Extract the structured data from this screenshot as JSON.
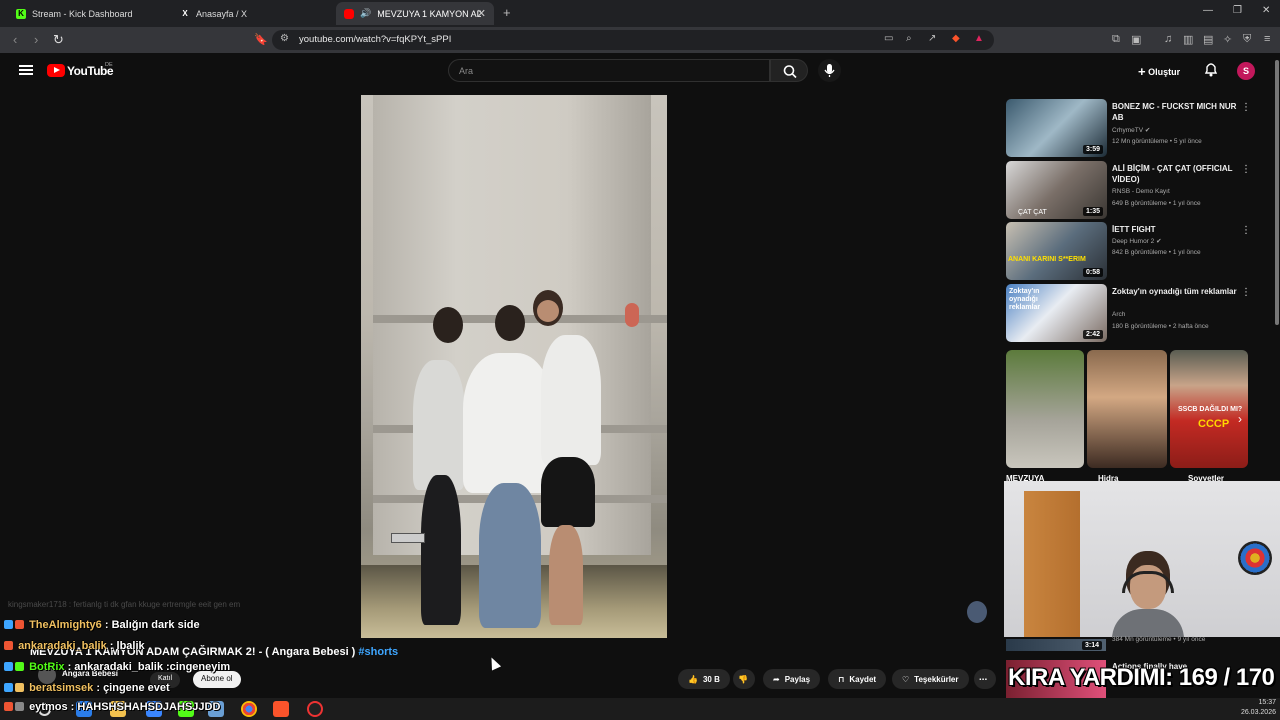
{
  "browser": {
    "tabs": [
      {
        "label": "Stream - Kick Dashboard",
        "icon": "kick-icon",
        "color": "#53fc18"
      },
      {
        "label": "Anasayfa / X",
        "icon": "x-icon",
        "color": "#ffffff"
      },
      {
        "label": "MEVZUYA 1 KAMYON ADAM",
        "icon": "youtube-icon",
        "color": "#ff0000",
        "active": true
      }
    ],
    "url": "youtube.com/watch?v=fqKPYt_sPPI"
  },
  "youtube": {
    "logo_text": "YouTube",
    "country_code": "DE",
    "search_placeholder": "Ara",
    "create_label": "Oluştur",
    "avatar_letter": "S"
  },
  "video": {
    "title": "MEVZUYA 1 KAMYON ADAM ÇAĞIRMAK 2! - ( Angara Bebesi )",
    "hashtag": "#shorts",
    "channel": "Angara Bebesi",
    "join_label": "Katıl",
    "subscribe_label": "Abone ol",
    "likes": "30 B",
    "share_label": "Paylaş",
    "save_label": "Kaydet",
    "thanks_label": "Teşekkürler"
  },
  "recommendations": [
    {
      "title": "BONEZ MC - FUCKST MICH NUR AB",
      "channel": "CrhymeTV",
      "meta": "12 Mn görüntüleme • 5 yıl önce",
      "duration": "3:59",
      "verified": true
    },
    {
      "title": "ALİ BİÇİM - ÇAT ÇAT (OFFICIAL VİDEO)",
      "channel": "RNSB - Demo Kayıt",
      "meta": "649 B görüntüleme • 1 yıl önce",
      "duration": "1:35",
      "verified": false
    },
    {
      "title": "İETT FIGHT",
      "channel": "Deep Humor 2",
      "meta": "842 B görüntüleme • 1 yıl önce",
      "duration": "0:58",
      "verified": true
    },
    {
      "title": "Zoktay'ın oynadığı tüm reklamlar",
      "channel": "Arch",
      "meta": "180 B görüntüleme • 2 hafta önce",
      "duration": "2:42",
      "verified": false
    }
  ],
  "shorts": [
    {
      "label": "MEVZUYA"
    },
    {
      "label": "Hidra"
    },
    {
      "label": "Sovyetler"
    }
  ],
  "hidden_rec": {
    "meta": "384 Mn görüntüleme • 9 yıl önce",
    "duration": "3:14",
    "title": "Actions finally have"
  },
  "chat": [
    {
      "user": "TheAlmighty6",
      "message": "Balığın dark side",
      "color": "#f0c060"
    },
    {
      "user": "ankaradaki_balik",
      "message": "lbalik",
      "color": "#f0c060"
    },
    {
      "user": "BotRix",
      "message": "ankaradaki_balik :cingeneyim",
      "color": "#53fc18"
    },
    {
      "user": "beratsimsek",
      "message": "çingene evet",
      "color": "#f0c060"
    },
    {
      "user": "eytmos",
      "message": "HAHSHSHAHSDJAHSJJDD",
      "color": "#ffffff"
    }
  ],
  "faded_chat": "kingsmaker1718 : fertianlg ti dk gfan kkuge ertremgle eeit gen em",
  "overlay": {
    "text": "KIRA YARDIMI: 169 / 170"
  },
  "clock": {
    "time": "15:37",
    "date": "26.03.2026"
  }
}
